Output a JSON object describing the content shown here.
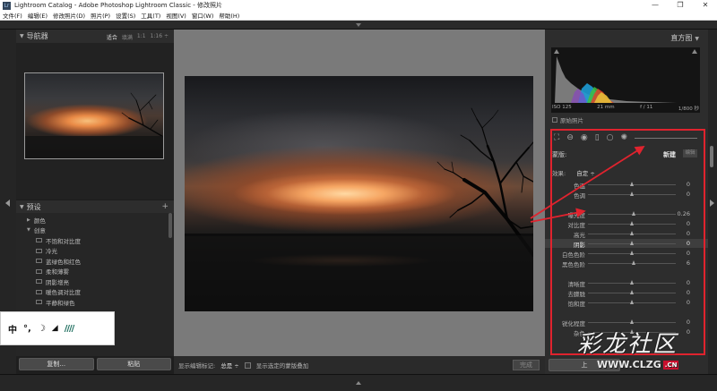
{
  "window": {
    "title": "Lightroom Catalog - Adobe Photoshop Lightroom Classic - 修改照片",
    "app_icon": "Lr",
    "minimize": "—",
    "maximize": "❐",
    "close": "✕"
  },
  "menu": [
    "文件(F)",
    "编辑(E)",
    "修改照片(D)",
    "照片(P)",
    "设置(S)",
    "工具(T)",
    "视图(V)",
    "窗口(W)",
    "帮助(H)"
  ],
  "navigator": {
    "title": "导航器",
    "options": [
      "适合",
      "填满",
      "1:1",
      "1:16 ÷"
    ]
  },
  "presets": {
    "title": "预设",
    "add": "+",
    "rows": [
      {
        "type": "folder",
        "label": "颜色",
        "expanded": false
      },
      {
        "type": "folder",
        "label": "创意",
        "expanded": true
      },
      {
        "type": "item",
        "label": "不饱和对比度"
      },
      {
        "type": "item",
        "label": "冷光"
      },
      {
        "type": "item",
        "label": "蓝绿色和红色"
      },
      {
        "type": "item",
        "label": "柔和薄雾"
      },
      {
        "type": "item",
        "label": "阴影增亮"
      },
      {
        "type": "item",
        "label": "暖色调对比度"
      },
      {
        "type": "item",
        "label": "平静和绿色"
      }
    ]
  },
  "ime_toolbar": {
    "lang": "中",
    "punct": "°,",
    "moon": "☽",
    "shirt": "👕",
    "slashes": "////"
  },
  "left_buttons": {
    "copy": "复制...",
    "paste": "粘贴"
  },
  "toolbar_bottom": {
    "label": "显示编辑标记:",
    "value": "总是 ÷",
    "overlay_label": "显示选定的蒙版叠加",
    "done": "完成"
  },
  "histogram": {
    "title": "直方图",
    "iso": "ISO 125",
    "focal": "21 mm",
    "aperture": "f / 11",
    "shutter": "1/800 秒",
    "original_label": "原始照片"
  },
  "brush": {
    "mask_label": "蒙版:",
    "new_label": "新建",
    "edit_label": "编辑",
    "effect_label": "效果:",
    "effect_value": "自定 ÷"
  },
  "sliders": [
    {
      "label": "色温",
      "value": "0",
      "pos": 0.5,
      "highlight": false,
      "offset": 0
    },
    {
      "label": "色调",
      "value": "0",
      "pos": 0.5,
      "highlight": false,
      "offset": 11
    },
    {
      "label": "曝光度",
      "value": "0.26",
      "pos": 0.53,
      "highlight": false,
      "offset": 33
    },
    {
      "label": "对比度",
      "value": "0",
      "pos": 0.5,
      "highlight": false,
      "offset": 44
    },
    {
      "label": "高光",
      "value": "0",
      "pos": 0.5,
      "highlight": false,
      "offset": 55
    },
    {
      "label": "阴影",
      "value": "0",
      "pos": 0.5,
      "highlight": true,
      "offset": 66
    },
    {
      "label": "白色色阶",
      "value": "0",
      "pos": 0.5,
      "highlight": false,
      "offset": 77
    },
    {
      "label": "黑色色阶",
      "value": "6",
      "pos": 0.53,
      "highlight": false,
      "offset": 88
    },
    {
      "label": "清晰度",
      "value": "0",
      "pos": 0.5,
      "highlight": false,
      "offset": 110
    },
    {
      "label": "去朦胧",
      "value": "0",
      "pos": 0.5,
      "highlight": false,
      "offset": 121
    },
    {
      "label": "饱和度",
      "value": "0",
      "pos": 0.5,
      "highlight": false,
      "offset": 132
    },
    {
      "label": "锐化程度",
      "value": "0",
      "pos": 0.5,
      "highlight": false,
      "offset": 154
    },
    {
      "label": "杂色",
      "value": "0",
      "pos": 0.5,
      "highlight": false,
      "offset": 165
    }
  ],
  "right_bottom": {
    "prev_button": "上"
  },
  "watermark": {
    "text": "彩龙社区",
    "url": "WWW.CLZG",
    "tld": ".CN"
  },
  "colors": {
    "annotation_red": "#e0232e",
    "panel_bg": "#2d2d2d",
    "center_bg": "#7a7a7a"
  }
}
